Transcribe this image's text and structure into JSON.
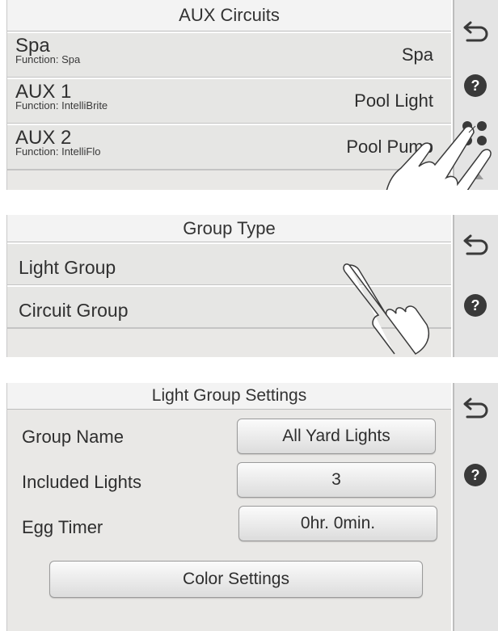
{
  "aux_panel": {
    "title": "AUX Circuits",
    "function_prefix": "Function:",
    "circuits": [
      {
        "name": "Spa",
        "function": "Function: Spa",
        "value": "Spa"
      },
      {
        "name": "AUX 1",
        "function": "Function: IntelliBrite",
        "value": "Pool Light"
      },
      {
        "name": "AUX 2",
        "function": "Function: IntelliFlo",
        "value": "Pool Pump"
      }
    ],
    "side_icons": [
      "back-arrow-icon",
      "help-icon",
      "more-options-icon",
      "scroll-up-icon"
    ]
  },
  "group_type_panel": {
    "title": "Group Type",
    "options": [
      "Light Group",
      "Circuit Group"
    ],
    "side_icons": [
      "back-arrow-icon",
      "help-icon"
    ]
  },
  "light_group_panel": {
    "title": "Light Group Settings",
    "fields": [
      {
        "label": "Group Name",
        "value": "All Yard Lights"
      },
      {
        "label": "Included Lights",
        "value": "3"
      },
      {
        "label": "Egg Timer",
        "value": "0hr. 0min."
      }
    ],
    "color_settings_label": "Color Settings",
    "side_icons": [
      "back-arrow-icon",
      "help-icon"
    ]
  },
  "help_glyph": "?",
  "colors": {
    "panel_bg": "#e6e6e4",
    "sidebar_bg": "#e4e4e4",
    "icon_dark": "#3a3a3a"
  }
}
